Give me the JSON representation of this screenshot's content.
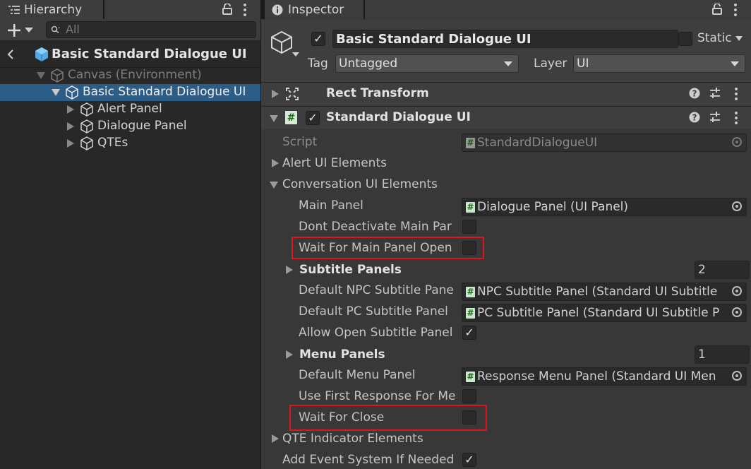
{
  "hierarchy": {
    "tab_label": "Hierarchy",
    "search_placeholder": "All",
    "scene_title": "Basic Standard Dialogue UI",
    "items": [
      {
        "label": "Canvas (Environment)",
        "dim": true
      },
      {
        "label": "Basic Standard Dialogue UI",
        "selected": true
      },
      {
        "label": "Alert Panel"
      },
      {
        "label": "Dialogue Panel"
      },
      {
        "label": "QTEs"
      }
    ]
  },
  "inspector": {
    "tab_label": "Inspector",
    "object_name": "Basic Standard Dialogue UI",
    "active": true,
    "static_label": "Static",
    "static_checked": false,
    "tag_label": "Tag",
    "tag_value": "Untagged",
    "layer_label": "Layer",
    "layer_value": "UI",
    "components": {
      "rect_transform": "Rect Transform",
      "standard_dialogue": "Standard Dialogue UI"
    },
    "props": {
      "script_label": "Script",
      "script_value": "StandardDialogueUI",
      "alert_ui": "Alert UI Elements",
      "conversation_ui": "Conversation UI Elements",
      "main_panel_label": "Main Panel",
      "main_panel_value": "Dialogue Panel (UI Panel)",
      "dont_deactivate_label": "Dont Deactivate Main Par",
      "dont_deactivate_checked": false,
      "wait_main_panel_label": "Wait For Main Panel Open",
      "wait_main_panel_checked": false,
      "subtitle_panels_label": "Subtitle Panels",
      "subtitle_panels_count": "2",
      "default_npc_label": "Default NPC Subtitle Pane",
      "default_npc_value": "NPC Subtitle Panel (Standard UI Subtitle",
      "default_pc_label": "Default PC Subtitle Panel",
      "default_pc_value": "PC Subtitle Panel (Standard UI Subtitle P",
      "allow_open_label": "Allow Open Subtitle Panel",
      "allow_open_checked": true,
      "menu_panels_label": "Menu Panels",
      "menu_panels_count": "1",
      "default_menu_label": "Default Menu Panel",
      "default_menu_value": "Response Menu Panel (Standard UI Men",
      "use_first_label": "Use First Response For Me",
      "use_first_checked": false,
      "wait_close_label": "Wait For Close",
      "wait_close_checked": false,
      "qte_label": "QTE Indicator Elements",
      "add_event_label": "Add Event System If Needed",
      "add_event_checked": true
    }
  },
  "colors": {
    "selection": "#2c5d87",
    "highlight_box": "#e0141c"
  }
}
